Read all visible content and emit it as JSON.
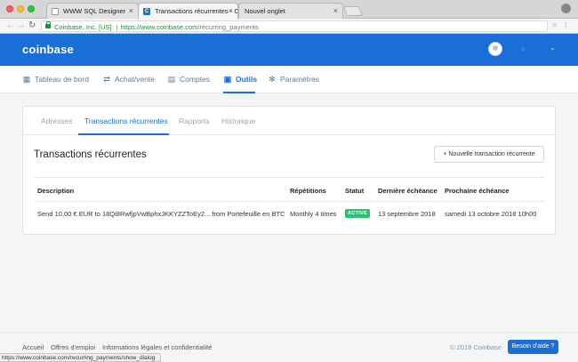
{
  "browser": {
    "tabs": [
      {
        "title": "WWW SQL Designer",
        "active": false,
        "favicon": "page-icon"
      },
      {
        "title": "Transactions récurrentes - Coi",
        "active": true,
        "favicon": "coinbase-icon"
      },
      {
        "title": "Nouvel onglet",
        "active": false,
        "favicon": "none"
      }
    ],
    "close_glyph": "×",
    "address": {
      "secure_label": "Coinbase, Inc. [US]",
      "separator": "|",
      "url_main": "https://www.coinbase.com",
      "url_path": "/recurring_payments"
    },
    "status_url": "https://www.coinbase.com/recurring_payments/show_dialog"
  },
  "header": {
    "logo": "coinbase",
    "chevron": "⌄"
  },
  "nav": {
    "items": [
      {
        "label": "Tableau de bord",
        "icon": "dashboard-icon",
        "glyph": "▦"
      },
      {
        "label": "Achat/vente",
        "icon": "swap-icon",
        "glyph": "⇄"
      },
      {
        "label": "Comptes",
        "icon": "wallet-icon",
        "glyph": "▤"
      },
      {
        "label": "Outils",
        "icon": "briefcase-icon",
        "glyph": "▣",
        "active": true
      },
      {
        "label": "Paramètres",
        "icon": "gear-icon",
        "glyph": "✻"
      }
    ]
  },
  "panel": {
    "tabs": [
      "Adresses",
      "Transactions récurrentes",
      "Rapports",
      "Historique"
    ],
    "active_tab": 1,
    "title": "Transactions récurrentes",
    "new_button": "+  Nouvelle transaction récurrente",
    "table": {
      "headers": [
        "Description",
        "Répétitions",
        "Statut",
        "Dernière échéance",
        "Prochaine échéance"
      ],
      "rows": [
        {
          "description": "Send 10,00 € EUR to 18Qi8RwfjpVwBphxJKKYZZToEy2... from Portefeuille en BTC",
          "repetitions": "Monthly 4 times",
          "status": "ACTIVE",
          "last": "13 septembre 2018",
          "next": "samedi 13 octobre 2018 10h00"
        }
      ]
    }
  },
  "footer": {
    "links": [
      "Accueil",
      "Offres d'emploi",
      "Informations légales et confidentialité"
    ],
    "copyright": "© 2018 Coinbase",
    "help": "Besoin d'aide ?"
  },
  "colors": {
    "brand": "#1a6fd6",
    "status_active": "#2fbf71"
  }
}
